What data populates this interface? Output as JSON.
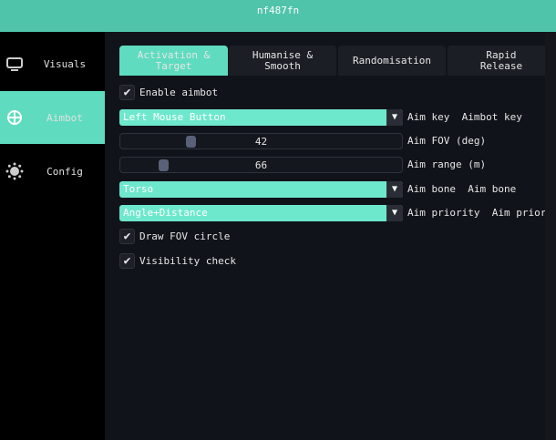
{
  "title": "nf487fn",
  "sidebar": {
    "items": [
      {
        "label": "Visuals",
        "icon": "monitor-icon"
      },
      {
        "label": "Aimbot",
        "icon": "crosshair-icon",
        "active": true
      },
      {
        "label": "Config",
        "icon": "gear-icon"
      }
    ]
  },
  "tabs": [
    {
      "label": "Activation &\nTarget",
      "active": true
    },
    {
      "label": "Humanise &\nSmooth"
    },
    {
      "label": "Randomisation"
    },
    {
      "label": "Rapid\nRelease"
    }
  ],
  "controls": {
    "enable_aimbot": {
      "label": "Enable aimbot",
      "checked": true
    },
    "aim_key": {
      "value": "Left Mouse Button",
      "label": "Aim key",
      "tooltip": "Aimbot key"
    },
    "aim_fov": {
      "value": "42",
      "label": "Aim FOV (deg)",
      "fraction": 0.24
    },
    "aim_range": {
      "value": "66",
      "label": "Aim range (m)",
      "fraction": 0.14
    },
    "aim_bone": {
      "value": "Torso",
      "label": "Aim bone",
      "tooltip": "Aim bone"
    },
    "aim_priority": {
      "value": "Angle+Distance",
      "label": "Aim priority",
      "tooltip": "Aim priority"
    },
    "draw_fov": {
      "label": "Draw FOV circle",
      "checked": true
    },
    "visibility": {
      "label": "Visibility check",
      "checked": true
    }
  },
  "colors": {
    "accent": "#5fdcbf",
    "titlebar": "#4fc4aa"
  }
}
